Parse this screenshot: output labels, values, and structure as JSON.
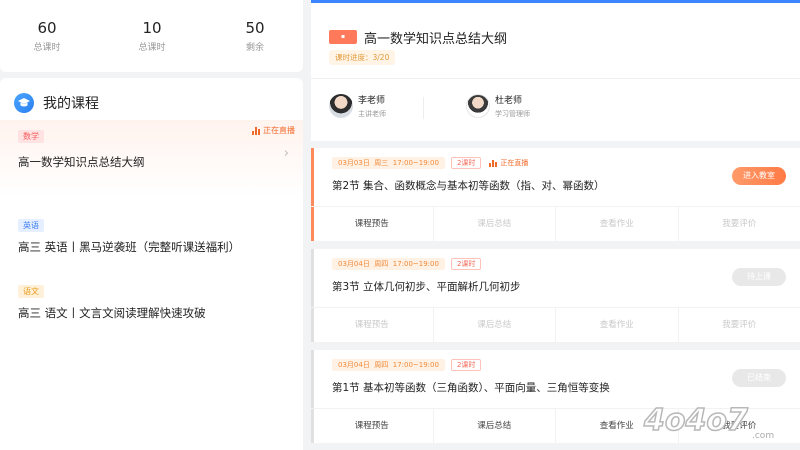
{
  "stats": [
    {
      "value": "60",
      "label": "总课时"
    },
    {
      "value": "10",
      "label": "总课时"
    },
    {
      "value": "50",
      "label": "剩余"
    }
  ],
  "my_courses": {
    "title": "我的课程",
    "live_label": "正在直播",
    "items": [
      {
        "tag": "数学",
        "name": "高一数学知识点总结大纲"
      },
      {
        "tag": "英语",
        "name": "高三 英语丨黑马逆袭班（完整听课送福利）"
      },
      {
        "tag": "语文",
        "name": "高三 语文丨文言文阅读理解快速攻破"
      }
    ]
  },
  "course_header": {
    "title": "高一数学知识点总结大纲",
    "progress": "课时进度：3/20",
    "teachers": [
      {
        "name": "李老师",
        "role": "主讲老师"
      },
      {
        "name": "杜老师",
        "role": "学习管理师"
      }
    ]
  },
  "lessons": [
    {
      "date": "03月03日",
      "weekday": "周三",
      "time": "17:00~19:00",
      "hours": "2课时",
      "live": "正在直播",
      "title": "第2节 集合、函数概念与基本初等函数（指、对、幂函数）",
      "button": "进入教室",
      "actions": [
        "课程预告",
        "课后总结",
        "查看作业",
        "我要评价"
      ]
    },
    {
      "date": "03月04日",
      "weekday": "周四",
      "time": "17:00~19:00",
      "hours": "2课时",
      "title": "第3节 立体几何初步、平面解析几何初步",
      "button": "待上课",
      "actions": [
        "课程预告",
        "课后总结",
        "查看作业",
        "我要评价"
      ]
    },
    {
      "date": "03月04日",
      "weekday": "周四",
      "time": "17:00~19:00",
      "hours": "2课时",
      "title": "第1节 基本初等函数（三角函数）、平面向量、三角恒等变换",
      "button": "已结束",
      "actions": [
        "课程预告",
        "课后总结",
        "查看作业",
        "我要评价"
      ]
    }
  ],
  "watermark": "4o4o7.com",
  "colors": {
    "accent": "#ff7a45",
    "primary": "#3b86ff"
  }
}
